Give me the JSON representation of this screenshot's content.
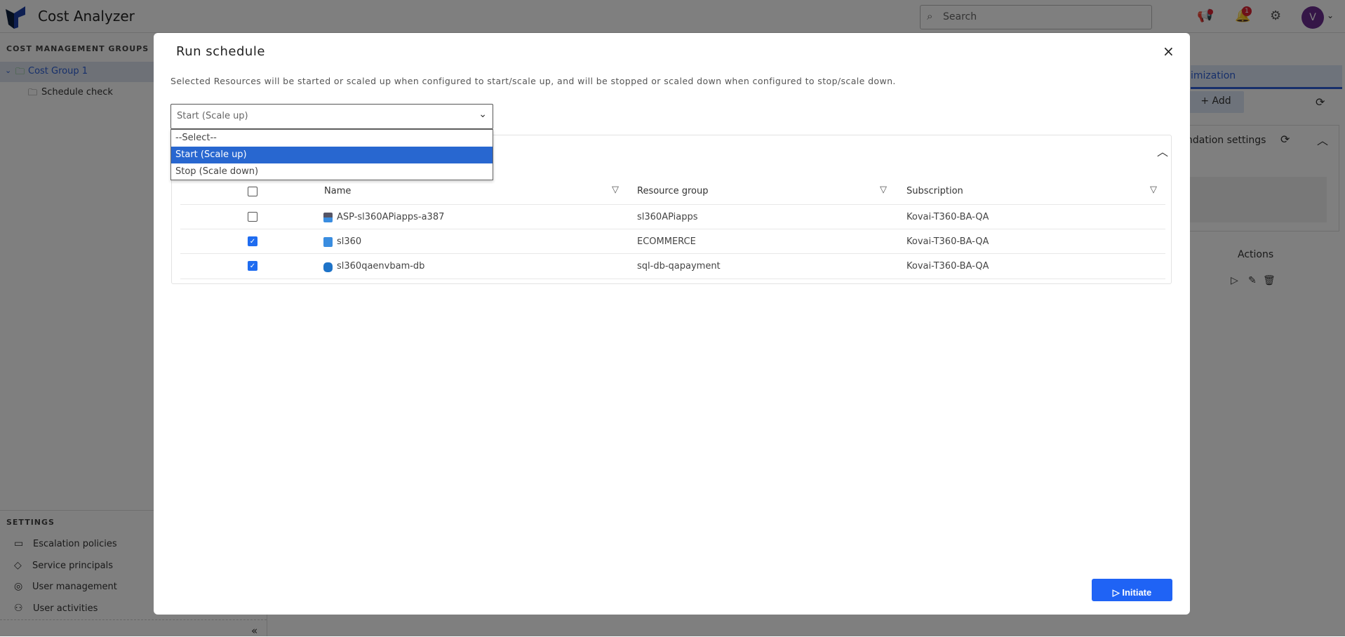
{
  "header": {
    "app_title": "Cost Analyzer",
    "search_placeholder": "Search",
    "notification_count": "1",
    "avatar_initial": "V"
  },
  "sidebar": {
    "groups_title": "COST MANAGEMENT GROUPS",
    "groups": [
      {
        "label": "Cost Group 1",
        "expanded": true
      },
      {
        "label": "Schedule check"
      }
    ],
    "settings_title": "SETTINGS",
    "settings_items": [
      {
        "label": "Escalation policies",
        "icon": "cast-icon"
      },
      {
        "label": "Service principals",
        "icon": "diamond-icon"
      },
      {
        "label": "User management",
        "icon": "user-circle-icon"
      },
      {
        "label": "User activities",
        "icon": "user-clock-icon"
      }
    ],
    "collapse": "«"
  },
  "background": {
    "tab": "imization",
    "add": "+ Add",
    "settings_title": "ndation settings",
    "actions": "Actions"
  },
  "modal": {
    "title": "Run schedule",
    "close": "×",
    "description": "Selected Resources will be started or scaled up when configured to start/scale up, and will be stopped or scaled down when configured to stop/scale down.",
    "select": {
      "value": "Start (Scale up)",
      "options": [
        "--Select--",
        "Start (Scale up)",
        "Stop (Scale down)"
      ],
      "selected_index": 1
    },
    "table": {
      "columns": [
        "Name",
        "Resource group",
        "Subscription"
      ],
      "rows": [
        {
          "checked": false,
          "icon": "app-service-plan-icon",
          "name": "ASP-sl360APiapps-a387",
          "resource_group": "sl360APiapps",
          "subscription": "Kovai-T360-BA-QA"
        },
        {
          "checked": true,
          "icon": "virtual-machine-icon",
          "name": "sl360",
          "resource_group": "ECOMMERCE",
          "subscription": "Kovai-T360-BA-QA"
        },
        {
          "checked": true,
          "icon": "sql-database-icon",
          "name": "sl360qaenvbam-db",
          "resource_group": "sql-db-qapayment",
          "subscription": "Kovai-T360-BA-QA"
        }
      ]
    },
    "initiate_label": "Initiate"
  },
  "colors": {
    "primary": "#1f63f5",
    "selected_option": "#2867d0",
    "avatar": "#6a2c8f"
  }
}
